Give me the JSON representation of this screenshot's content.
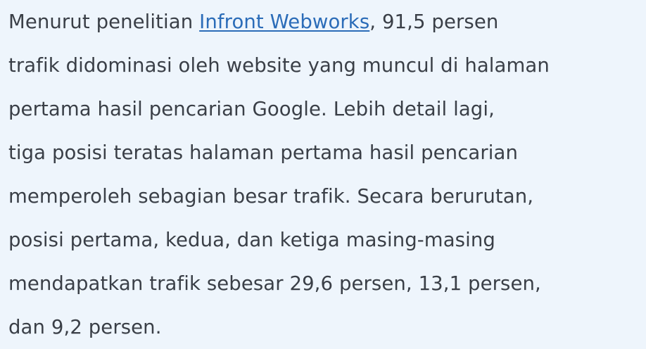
{
  "article": {
    "paragraph": {
      "lines": [
        {
          "before": "Menurut penelitian ",
          "link": "Infront Webworks",
          "after": ", 91,5 persen"
        },
        {
          "text": "trafik didominasi oleh website yang muncul di halaman"
        },
        {
          "text": "pertama hasil pencarian Google. Lebih detail lagi,"
        },
        {
          "text": "tiga posisi teratas halaman pertama hasil pencarian"
        },
        {
          "text": "memperoleh sebagian besar trafik. Secara berurutan,"
        },
        {
          "text": "posisi pertama, kedua, dan ketiga masing-masing"
        },
        {
          "text": "mendapatkan trafik sebesar 29,6 persen, 13,1 persen,"
        },
        {
          "text": "dan 9,2 persen."
        }
      ]
    }
  },
  "colors": {
    "background": "#eef5fc",
    "text": "#3a3f47",
    "link": "#2b6cb8"
  }
}
